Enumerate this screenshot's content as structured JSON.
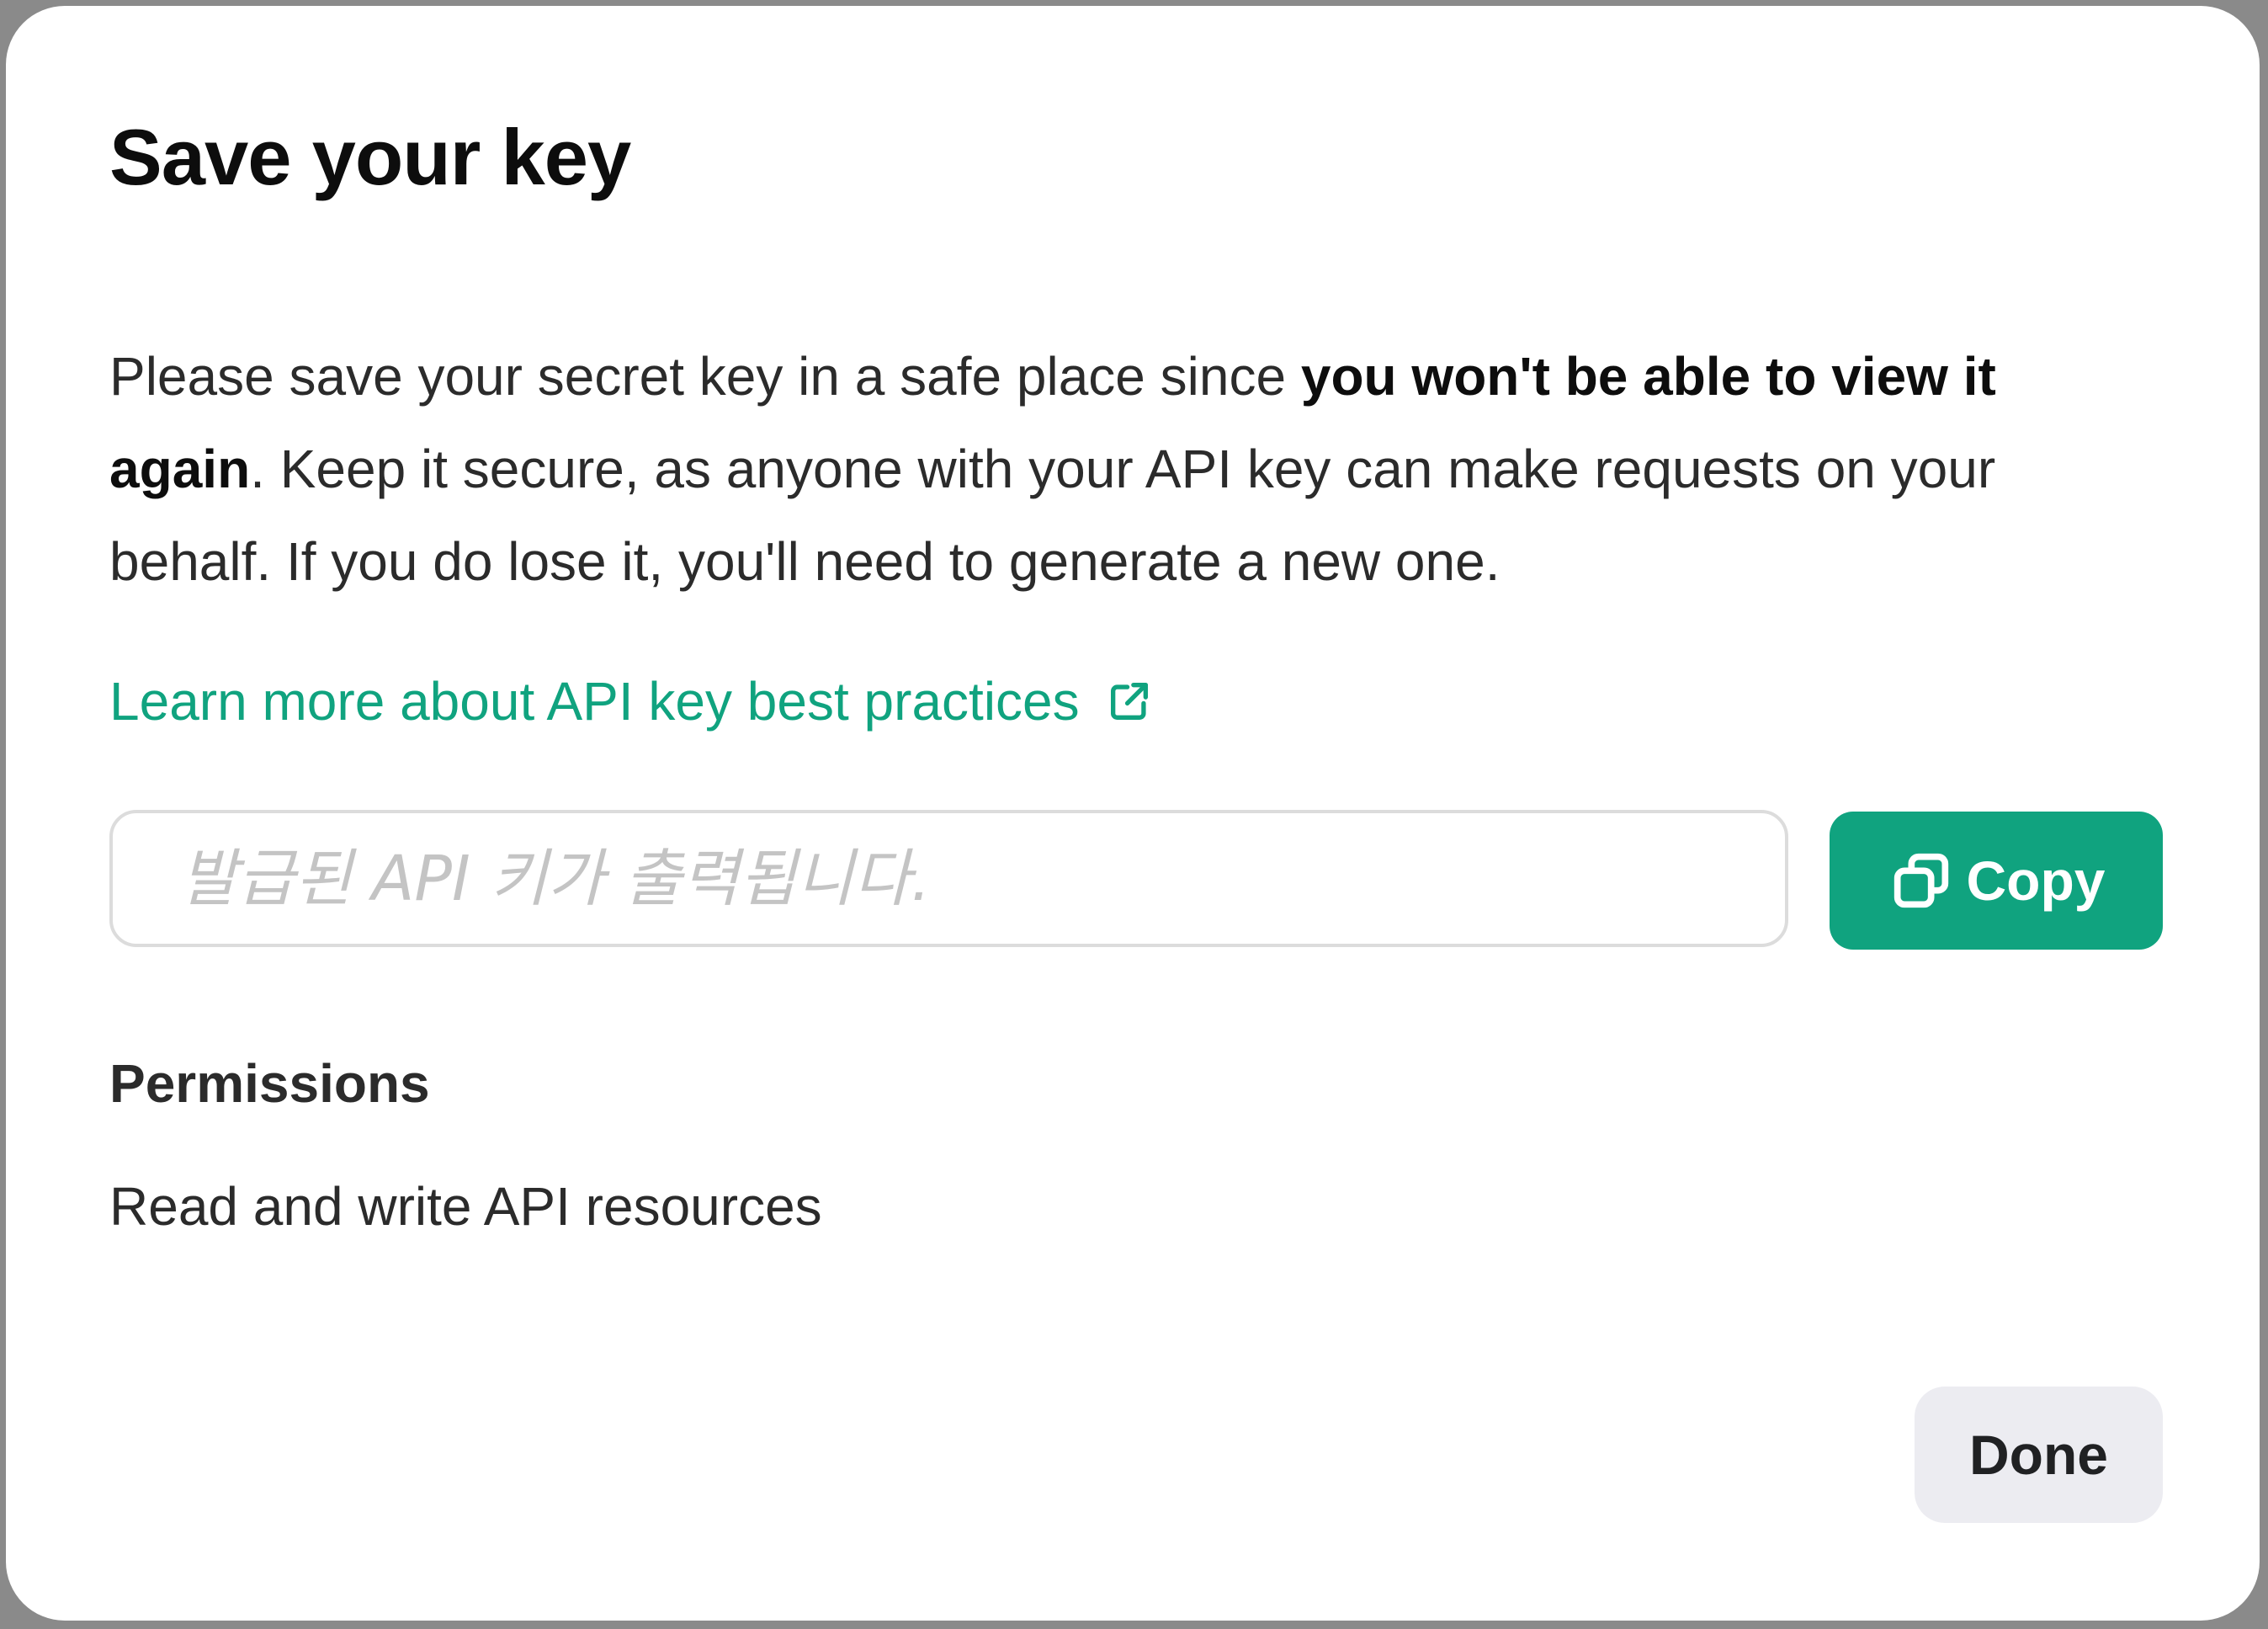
{
  "dialog": {
    "title": "Save your key",
    "description": {
      "part1": "Please save your secret key in a safe place since ",
      "emphasis": "you won't be able to view it again",
      "part2": ". Keep it secure, as anyone with your API key can make requests on your behalf. If you do lose it, you'll need to generate a new one."
    },
    "learn_link": {
      "label": "Learn more about API key best practices",
      "icon": "external-link-icon"
    },
    "key_field": {
      "value": "",
      "placeholder": "발급된 API 키가 출력됩니다."
    },
    "copy_button": {
      "label": "Copy",
      "icon": "copy-icon"
    },
    "permissions": {
      "heading": "Permissions",
      "value": "Read and write API resources"
    },
    "done_button": {
      "label": "Done"
    }
  },
  "colors": {
    "accent": "#10a37f",
    "secondary_button_bg": "#ececf1",
    "text": "#2b2b2b",
    "backdrop": "#8a8a8a"
  }
}
